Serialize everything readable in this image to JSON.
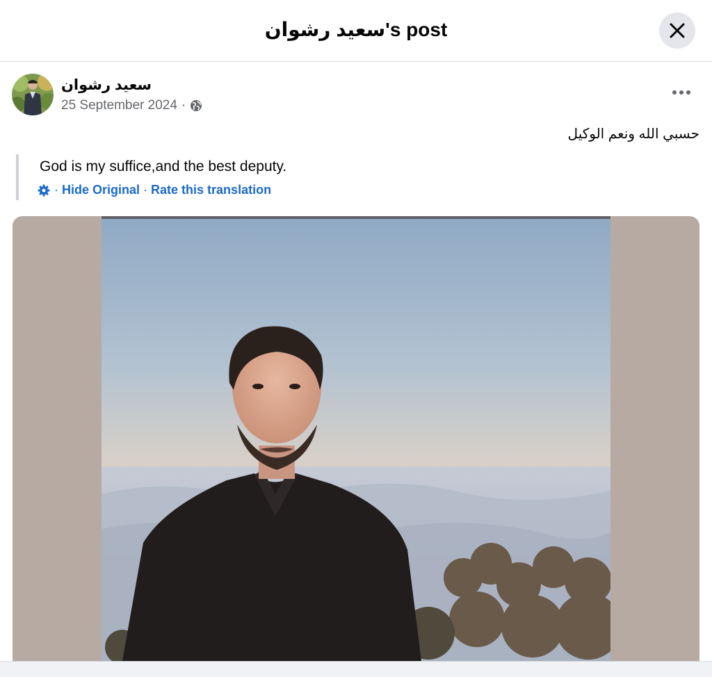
{
  "header": {
    "title": "سعيد رشوان's post"
  },
  "post": {
    "author": "سعيد رشوان",
    "date": "25 September 2024",
    "meta_separator": "·",
    "visibility_icon": "globe-icon",
    "more_label": "•••",
    "text": "حسبي الله ونعم الوكيل",
    "translation": {
      "text": "God is my suffice,and the best deputy.",
      "settings_icon": "gear-icon",
      "separator": "·",
      "hide_original": "Hide Original",
      "rate": "Rate this translation"
    }
  },
  "colors": {
    "link": "#1b6ac9",
    "secondary_text": "#65676b",
    "frame_background": "#b7aaa3",
    "close_button_bg": "#e4e6eb"
  }
}
